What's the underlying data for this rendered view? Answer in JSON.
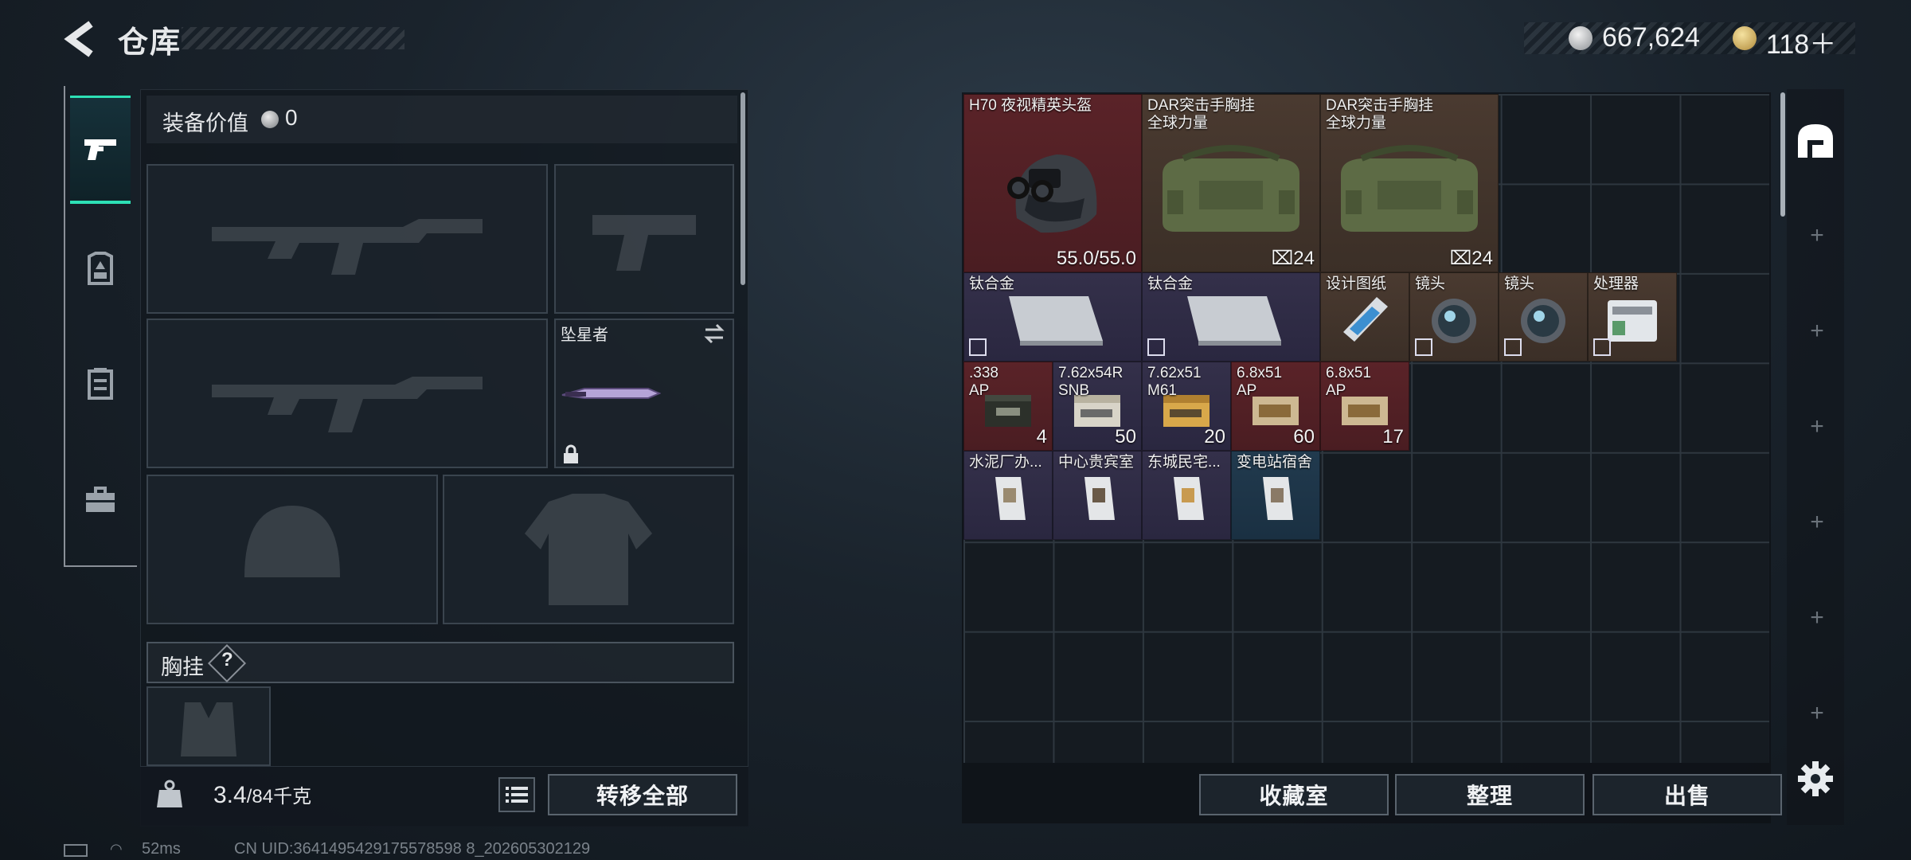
{
  "header": {
    "title": "仓库",
    "silver_amount": "667,624",
    "gold_amount": "118＋"
  },
  "rail": {
    "icons": [
      "pistol-icon",
      "armor-icon",
      "rig-icon",
      "briefcase-icon"
    ],
    "active": "weapons",
    "accent_color": "#2de0b5"
  },
  "equipment": {
    "value_label": "装备价值",
    "value_amount": "0",
    "melee_name": "坠星者",
    "rig_label": "胸挂",
    "rig_help": "?"
  },
  "footer_left": {
    "weight_value": "3.4",
    "weight_max": "/84千克",
    "transfer_all": "转移全部"
  },
  "status": {
    "ping": "52ms",
    "uid": "CN UID:3641495429175578598 8_202605302129"
  },
  "stash": {
    "items": [
      {
        "name": "H70 夜视精英头盔",
        "count": "55.0/55.0",
        "color": "#5a2328"
      },
      {
        "name": "DAR突击手胸挂\n全球力量",
        "count": "24",
        "color": "#4a3a30"
      },
      {
        "name": "DAR突击手胸挂\n全球力量",
        "count": "24",
        "color": "#4a3a30"
      },
      {
        "name": "钛合金",
        "count": "",
        "color": "#34304a"
      },
      {
        "name": "钛合金",
        "count": "",
        "color": "#34304a"
      },
      {
        "name": "设计图纸",
        "count": "",
        "color": "#4a3a30"
      },
      {
        "name": "镜头",
        "count": "",
        "color": "#4a3a30"
      },
      {
        "name": "镜头",
        "count": "",
        "color": "#4a3a30"
      },
      {
        "name": "处理器",
        "count": "",
        "color": "#4a3a30"
      },
      {
        "name": ".338\nAP",
        "count": "4",
        "color": "#5a2328"
      },
      {
        "name": "7.62x54R\nSNB",
        "count": "50",
        "color": "#34304a"
      },
      {
        "name": "7.62x51\nM61",
        "count": "20",
        "color": "#34304a"
      },
      {
        "name": "6.8x51\nAP",
        "count": "60",
        "color": "#5a2328"
      },
      {
        "name": "6.8x51\nAP",
        "count": "17",
        "color": "#5a2328"
      },
      {
        "name": "水泥厂办...",
        "count": "",
        "color": "#34304a"
      },
      {
        "name": "中心贵宾室",
        "count": "",
        "color": "#34304a"
      },
      {
        "name": "东城民宅...",
        "count": "",
        "color": "#34304a"
      },
      {
        "name": "变电站宿舍",
        "count": "",
        "color": "#213a4e"
      }
    ]
  },
  "buttons": {
    "collection": "收藏室",
    "sort": "整理",
    "sell": "出售"
  }
}
